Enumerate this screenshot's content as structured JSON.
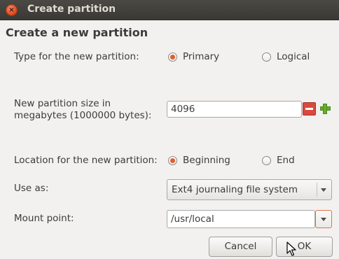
{
  "window": {
    "title": "Create partition",
    "close_glyph": "×"
  },
  "heading": "Create a new partition",
  "type": {
    "label": "Type for the new partition:",
    "options": [
      {
        "label": "Primary",
        "selected": true
      },
      {
        "label": "Logical",
        "selected": false
      }
    ]
  },
  "size": {
    "label_line1": "New partition size in",
    "label_line2": "megabytes (1000000 bytes):",
    "value": "4096"
  },
  "location": {
    "label": "Location for the new partition:",
    "options": [
      {
        "label": "Beginning",
        "selected": true
      },
      {
        "label": "End",
        "selected": false
      }
    ]
  },
  "use_as": {
    "label": "Use as:",
    "value": "Ext4 journaling file system"
  },
  "mount_point": {
    "label": "Mount point:",
    "value": "/usr/local"
  },
  "buttons": {
    "cancel": "Cancel",
    "ok": "OK"
  },
  "colors": {
    "accent": "#e35d2f",
    "titlebar": "#3c3b37",
    "background": "#f2f1f0"
  }
}
